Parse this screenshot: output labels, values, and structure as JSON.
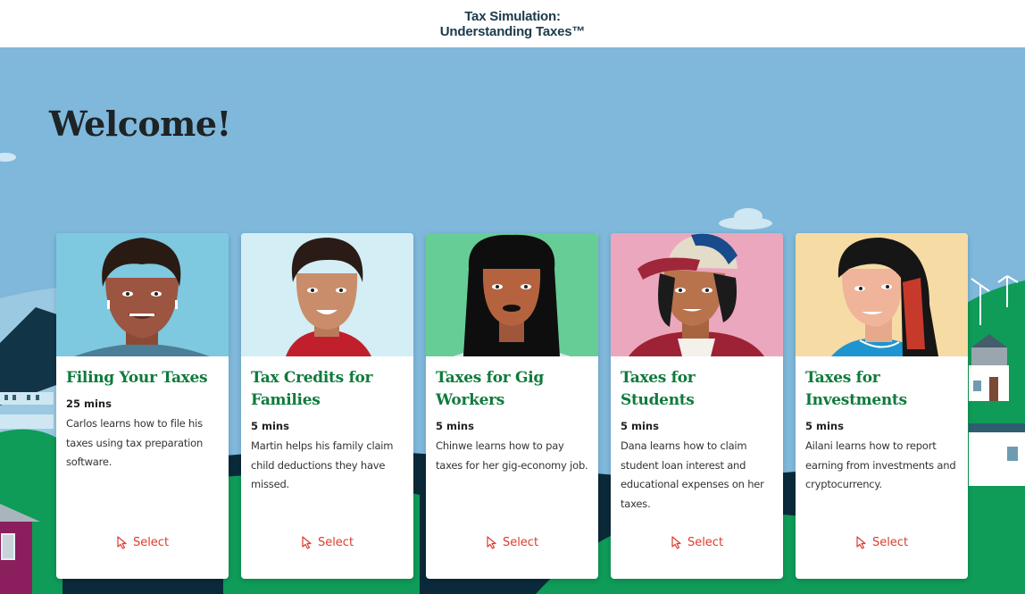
{
  "header": {
    "title_line1": "Tax Simulation:",
    "title_line2": "Understanding Taxes™"
  },
  "welcome": "Welcome!",
  "colors": {
    "header_text": "#1b3a4b",
    "sky": "#7fb8db",
    "card_title": "#0f7a3c",
    "select_accent": "#e03a2c",
    "hills": "#0f9b58"
  },
  "cards": [
    {
      "title": "Filing Your Taxes",
      "duration": "25 mins",
      "description": "Carlos learns how to file his taxes using tax preparation software.",
      "character": "Carlos",
      "portrait_bg": "#7ec8e0",
      "select_label": "Select",
      "select_icon": "pointer-cursor-icon"
    },
    {
      "title": "Tax Credits for Families",
      "duration": "5 mins",
      "description": "Martin helps his family claim child deductions they have missed.",
      "character": "Martin",
      "portrait_bg": "#d3eef5",
      "select_label": "Select",
      "select_icon": "pointer-cursor-icon"
    },
    {
      "title": "Taxes for Gig Workers",
      "duration": "5 mins",
      "description": "Chinwe learns how to pay taxes for her gig-economy job.",
      "character": "Chinwe",
      "portrait_bg": "#66cd96",
      "select_label": "Select",
      "select_icon": "pointer-cursor-icon"
    },
    {
      "title": "Taxes for Students",
      "duration": "5 mins",
      "description": "Dana learns how to claim student loan interest and educational expenses on her taxes.",
      "character": "Dana",
      "portrait_bg": "#eba7bd",
      "select_label": "Select",
      "select_icon": "pointer-cursor-icon"
    },
    {
      "title": "Taxes for Investments",
      "duration": "5 mins",
      "description": "Ailani learns how to report earning from investments and cryptocurrency.",
      "character": "Ailani",
      "portrait_bg": "#f6dba5",
      "select_label": "Select",
      "select_icon": "pointer-cursor-icon"
    }
  ]
}
